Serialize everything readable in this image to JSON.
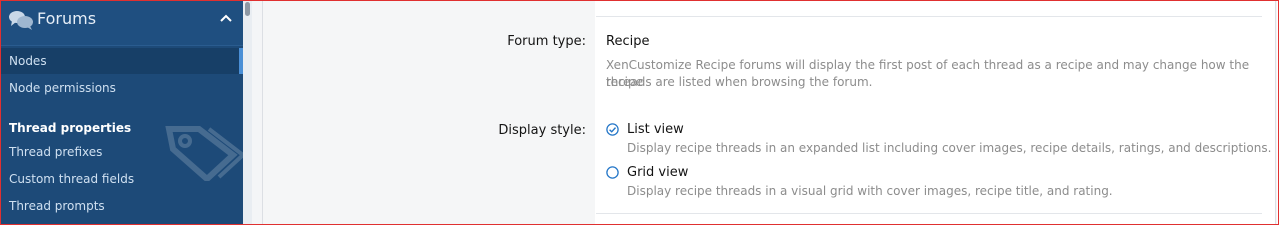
{
  "sidebar": {
    "section_title": "Forums",
    "section_icon": "chat-bubbles-icon",
    "collapse_icon": "chevron-up-icon",
    "items": [
      {
        "label": "Nodes",
        "active": true
      },
      {
        "label": "Node permissions",
        "active": false
      }
    ],
    "group_heading": "Thread properties",
    "group_icon": "tag-icon",
    "group_items": [
      {
        "label": "Thread prefixes"
      },
      {
        "label": "Custom thread fields"
      },
      {
        "label": "Thread prompts"
      }
    ]
  },
  "form": {
    "forum_type": {
      "label": "Forum type:",
      "value": "Recipe",
      "description_line1": "XenCustomize Recipe forums will display the first post of each thread as a recipe and may change how the recipe",
      "description_line2": "threads are listed when browsing the forum."
    },
    "display_style": {
      "label": "Display style:",
      "options": [
        {
          "label": "List view",
          "selected": true,
          "description": "Display recipe threads in an expanded list including cover images, recipe details, ratings, and descriptions."
        },
        {
          "label": "Grid view",
          "selected": false,
          "description": "Display recipe threads in a visual grid with cover images, recipe title, and rating."
        }
      ]
    }
  },
  "colors": {
    "sidebar_bg": "#1d4a78",
    "accent": "#2577c8",
    "frame": "#e03030"
  }
}
